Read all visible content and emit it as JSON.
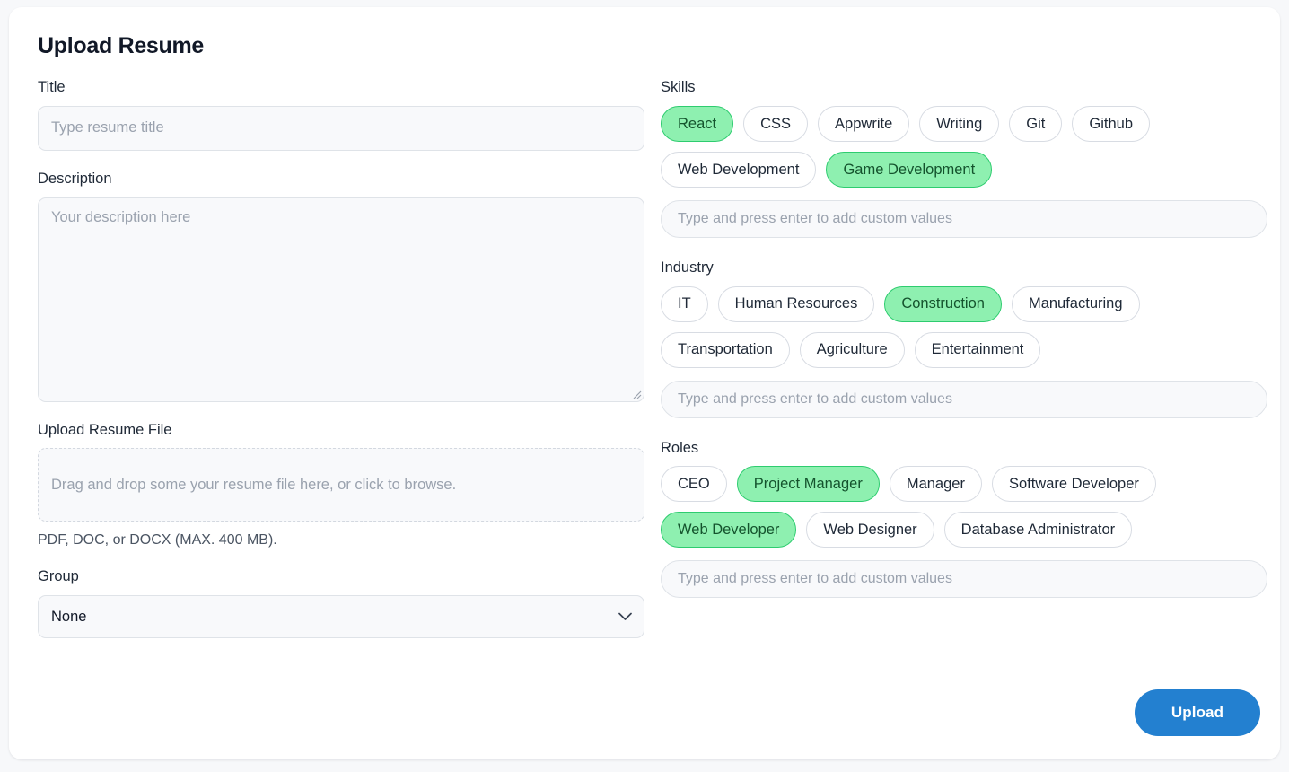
{
  "card": {
    "title": "Upload Resume"
  },
  "left": {
    "title_label": "Title",
    "title_placeholder": "Type resume title",
    "title_value": "",
    "description_label": "Description",
    "description_placeholder": "Your description here",
    "description_value": "",
    "upload_label": "Upload Resume File",
    "dropzone_text": "Drag and drop some your resume file here, or click to browse.",
    "file_hint": "PDF, DOC, or DOCX (MAX. 400 MB).",
    "group_label": "Group",
    "group_selected": "None",
    "group_options": [
      "None"
    ]
  },
  "skills": {
    "label": "Skills",
    "custom_placeholder": "Type and press enter to add custom values",
    "custom_value": "",
    "chips": [
      {
        "label": "React",
        "selected": true
      },
      {
        "label": "CSS",
        "selected": false
      },
      {
        "label": "Appwrite",
        "selected": false
      },
      {
        "label": "Writing",
        "selected": false
      },
      {
        "label": "Git",
        "selected": false
      },
      {
        "label": "Github",
        "selected": false
      },
      {
        "label": "Web Development",
        "selected": false
      },
      {
        "label": "Game Development",
        "selected": true
      }
    ]
  },
  "industry": {
    "label": "Industry",
    "custom_placeholder": "Type and press enter to add custom values",
    "custom_value": "",
    "chips": [
      {
        "label": "IT",
        "selected": false
      },
      {
        "label": "Human Resources",
        "selected": false
      },
      {
        "label": "Construction",
        "selected": true
      },
      {
        "label": "Manufacturing",
        "selected": false
      },
      {
        "label": "Transportation",
        "selected": false
      },
      {
        "label": "Agriculture",
        "selected": false
      },
      {
        "label": "Entertainment",
        "selected": false
      }
    ]
  },
  "roles": {
    "label": "Roles",
    "custom_placeholder": "Type and press enter to add custom values",
    "custom_value": "",
    "chips": [
      {
        "label": "CEO",
        "selected": false
      },
      {
        "label": "Project Manager",
        "selected": true
      },
      {
        "label": "Manager",
        "selected": false
      },
      {
        "label": "Software Developer",
        "selected": false
      },
      {
        "label": "Web Developer",
        "selected": true
      },
      {
        "label": "Web Designer",
        "selected": false
      },
      {
        "label": "Database Administrator",
        "selected": false
      }
    ]
  },
  "footer": {
    "upload_label": "Upload"
  },
  "colors": {
    "accent": "#2380d0",
    "chip_selected_bg": "#8ef0b0",
    "chip_selected_border": "#2ecc6f",
    "page_bg": "#f7f8fa",
    "card_bg": "#ffffff"
  }
}
